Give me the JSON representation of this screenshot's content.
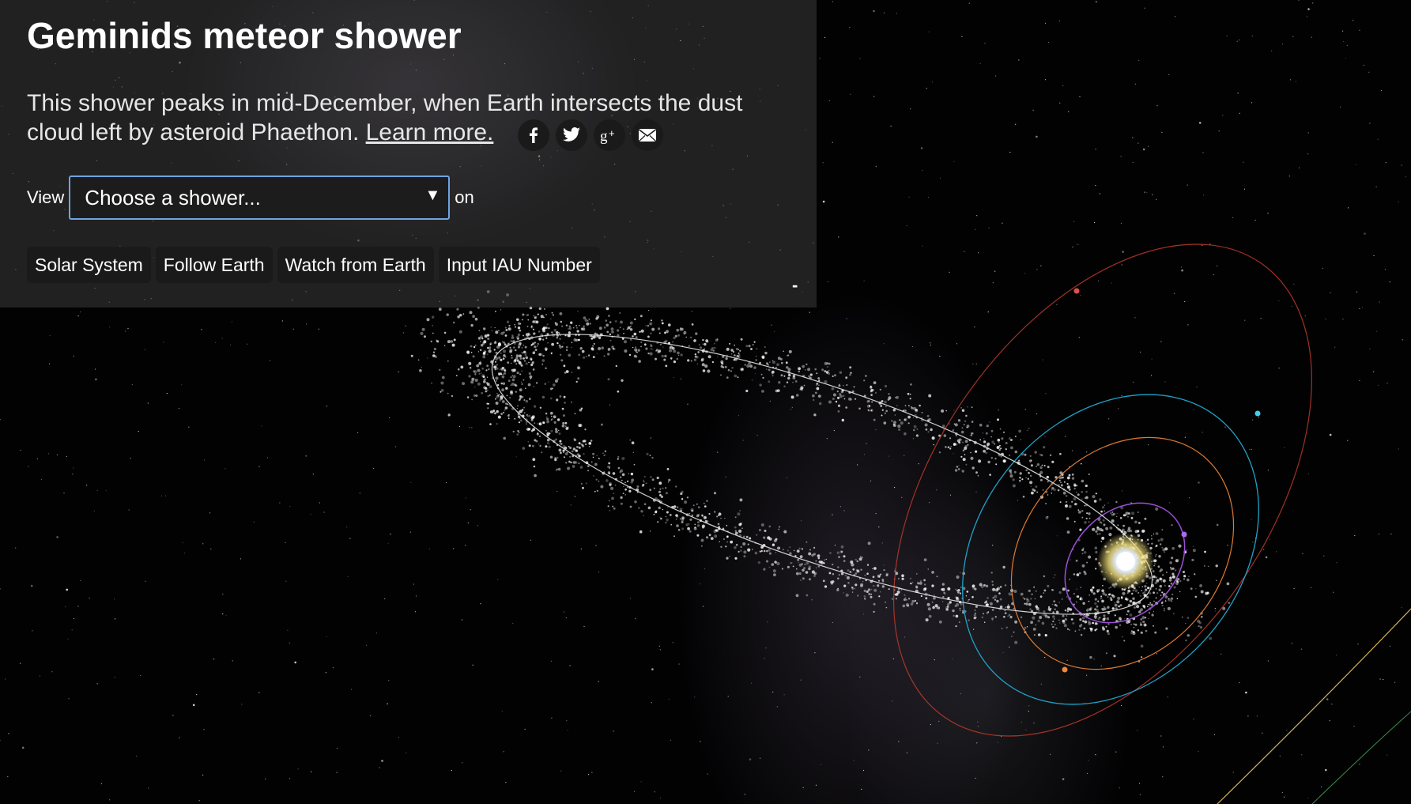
{
  "header": {
    "title": "Geminids meteor shower",
    "description": "This shower peaks in mid-December, when Earth intersects the dust cloud left by asteroid Phaethon.",
    "learn_more": "Learn more."
  },
  "share_icons": [
    "facebook-icon",
    "twitter-icon",
    "google-plus-icon",
    "email-icon"
  ],
  "view": {
    "prefix": "View",
    "select_value": "Choose a shower...",
    "suffix": "on"
  },
  "buttons": {
    "solar_system": "Solar System",
    "follow_earth": "Follow Earth",
    "watch_from_earth": "Watch from Earth",
    "input_iau": "Input IAU Number"
  },
  "collapse_label": "-",
  "colors": {
    "accent_border": "#6fa3e0",
    "orbit_outer": "#c0392b",
    "orbit_cyan": "#1fa3c8",
    "orbit_orange": "#e07a2e",
    "orbit_purple": "#9b4fd6",
    "meteor_stream": "#ffffff"
  }
}
